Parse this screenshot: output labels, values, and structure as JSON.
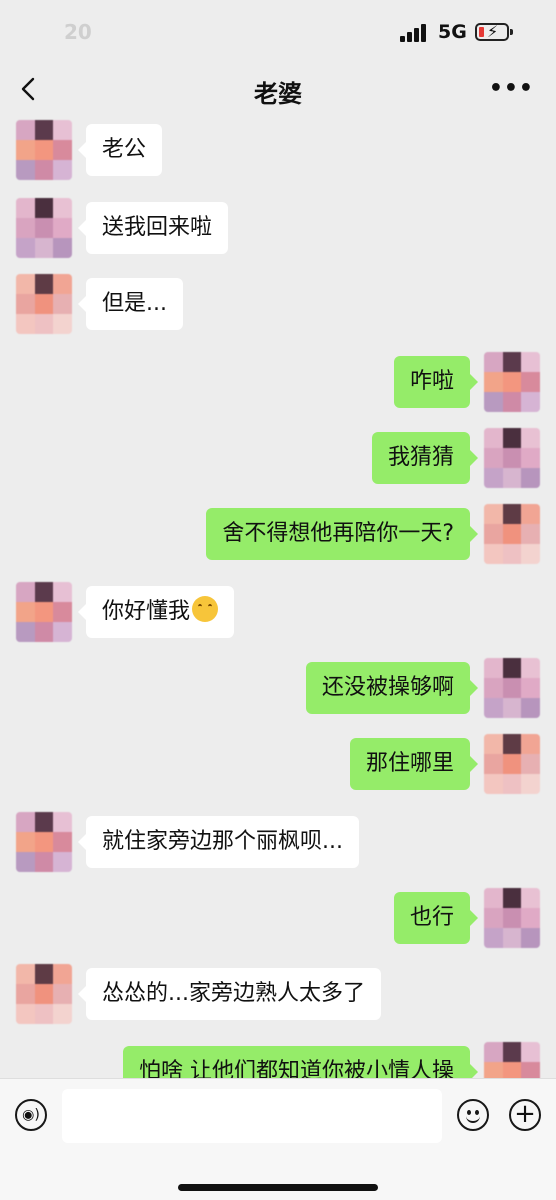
{
  "status_bar": {
    "time": "20",
    "network": "5G",
    "signal_icon": "signal-icon",
    "battery_icon": "battery-low-charging-icon"
  },
  "nav": {
    "title": "老婆",
    "back_icon": "chevron-left-icon",
    "more_label": "•••"
  },
  "messages": [
    {
      "side": "left",
      "text": "老公"
    },
    {
      "side": "left",
      "text": "送我回来啦"
    },
    {
      "side": "left",
      "text": "但是..."
    },
    {
      "side": "right",
      "text": "咋啦"
    },
    {
      "side": "right",
      "text": "我猜猜"
    },
    {
      "side": "right",
      "text": "舍不得想他再陪你一天?"
    },
    {
      "side": "left",
      "text": "你好懂我",
      "emoji": "thinking-face-icon"
    },
    {
      "side": "right",
      "text": "还没被操够啊"
    },
    {
      "side": "right",
      "text": "那住哪里"
    },
    {
      "side": "left",
      "text": "就住家旁边那个丽枫呗..."
    },
    {
      "side": "right",
      "text": "也行"
    },
    {
      "side": "left",
      "text": "怂怂的...家旁边熟人太多了"
    },
    {
      "side": "right",
      "text": "怕啥 让他们都知道你被小情人操"
    }
  ],
  "input_bar": {
    "placeholder": "",
    "voice_label": "◉)",
    "plus_label": "+"
  },
  "colors": {
    "background": "#ededed",
    "self_bubble": "#95ec69",
    "other_bubble": "#ffffff"
  }
}
